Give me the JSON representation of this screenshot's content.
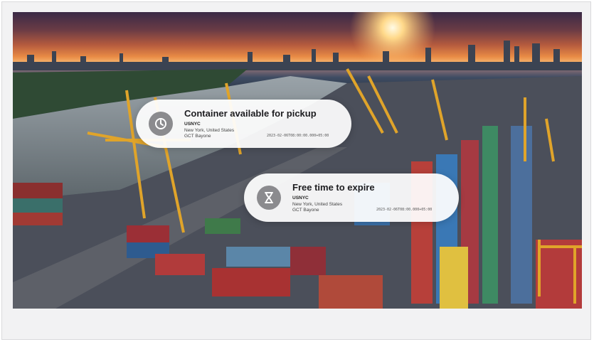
{
  "cards": [
    {
      "title": "Container available for pickup",
      "location_code": "USNYC",
      "city": "New York, United States",
      "terminal": "GCT Bayone",
      "timestamp": "2023-02-06T08:00:00.000+05:00",
      "icon": "clock-icon"
    },
    {
      "title": "Free time to expire",
      "location_code": "USNYC",
      "city": "New York, United States",
      "terminal": "GCT Bayone",
      "timestamp": "2023-02-06T08:00.000+05:00",
      "icon": "hourglass-icon"
    }
  ],
  "colors": {
    "card_bg": "#ffffff",
    "badge_bg": "#8b8b8e",
    "sunset": "#f6b26b"
  }
}
